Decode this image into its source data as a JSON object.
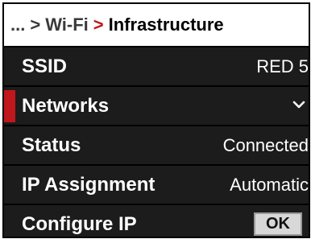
{
  "colors": {
    "accent": "#c0171c",
    "row_background": "#1c1c1c",
    "breadcrumb_background": "#ffffff"
  },
  "breadcrumb": {
    "ellipsis": "...",
    "separator_1": ">",
    "parent": "Wi-Fi",
    "separator_2": ">",
    "current": "Infrastructure"
  },
  "settings": {
    "ssid": {
      "label": "SSID",
      "value": "RED 5"
    },
    "networks": {
      "label": "Networks",
      "icon": "chevron-down-icon",
      "selected": true
    },
    "status": {
      "label": "Status",
      "value": "Connected"
    },
    "ip_assignment": {
      "label": "IP Assignment",
      "value": "Automatic"
    },
    "configure_ip": {
      "label": "Configure IP",
      "button_label": "OK"
    }
  }
}
